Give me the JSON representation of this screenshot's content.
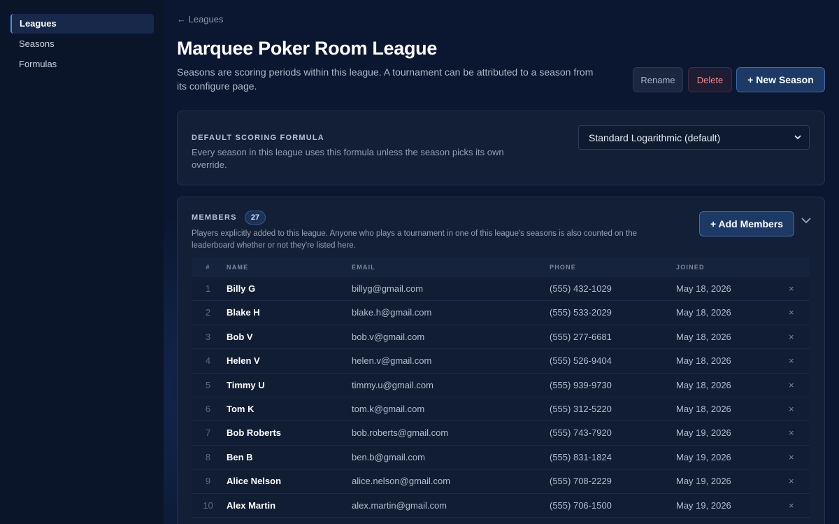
{
  "sidebar": {
    "items": [
      {
        "label": "Leagues"
      },
      {
        "label": "Seasons"
      },
      {
        "label": "Formulas"
      }
    ]
  },
  "header": {
    "back_label": "← Leagues",
    "title": "Marquee Poker Room League",
    "description": "Seasons are scoring periods within this league. A tournament can be attributed to a season from its configure page.",
    "rename_label": "Rename",
    "delete_label": "Delete",
    "new_season_label": "+ New Season"
  },
  "formula": {
    "heading": "DEFAULT SCORING FORMULA",
    "description": "Every season in this league uses this formula unless the season picks its own override.",
    "selected": "Standard Logarithmic (default)"
  },
  "members": {
    "heading": "MEMBERS",
    "count": "27",
    "description": "Players explicitly added to this league. Anyone who plays a tournament in one of this league's seasons is also counted on the leaderboard whether or not they're listed here.",
    "add_label": "+ Add Members",
    "columns": {
      "num": "#",
      "name": "NAME",
      "email": "EMAIL",
      "phone": "PHONE",
      "joined": "JOINED"
    },
    "remove_glyph": "×",
    "rows": [
      {
        "num": "1",
        "name": "Billy G",
        "email": "billyg@gmail.com",
        "phone": "(555) 432-1029",
        "joined": "May 18, 2026"
      },
      {
        "num": "2",
        "name": "Blake H",
        "email": "blake.h@gmail.com",
        "phone": "(555) 533-2029",
        "joined": "May 18, 2026"
      },
      {
        "num": "3",
        "name": "Bob V",
        "email": "bob.v@gmail.com",
        "phone": "(555) 277-6681",
        "joined": "May 18, 2026"
      },
      {
        "num": "4",
        "name": "Helen V",
        "email": "helen.v@gmail.com",
        "phone": "(555) 526-9404",
        "joined": "May 18, 2026"
      },
      {
        "num": "5",
        "name": "Timmy U",
        "email": "timmy.u@gmail.com",
        "phone": "(555) 939-9730",
        "joined": "May 18, 2026"
      },
      {
        "num": "6",
        "name": "Tom K",
        "email": "tom.k@gmail.com",
        "phone": "(555) 312-5220",
        "joined": "May 18, 2026"
      },
      {
        "num": "7",
        "name": "Bob Roberts",
        "email": "bob.roberts@gmail.com",
        "phone": "(555) 743-7920",
        "joined": "May 19, 2026"
      },
      {
        "num": "8",
        "name": "Ben B",
        "email": "ben.b@gmail.com",
        "phone": "(555) 831-1824",
        "joined": "May 19, 2026"
      },
      {
        "num": "9",
        "name": "Alice Nelson",
        "email": "alice.nelson@gmail.com",
        "phone": "(555) 708-2229",
        "joined": "May 19, 2026"
      },
      {
        "num": "10",
        "name": "Alex Martin",
        "email": "alex.martin@gmail.com",
        "phone": "(555) 706-1500",
        "joined": "May 19, 2026"
      }
    ]
  }
}
